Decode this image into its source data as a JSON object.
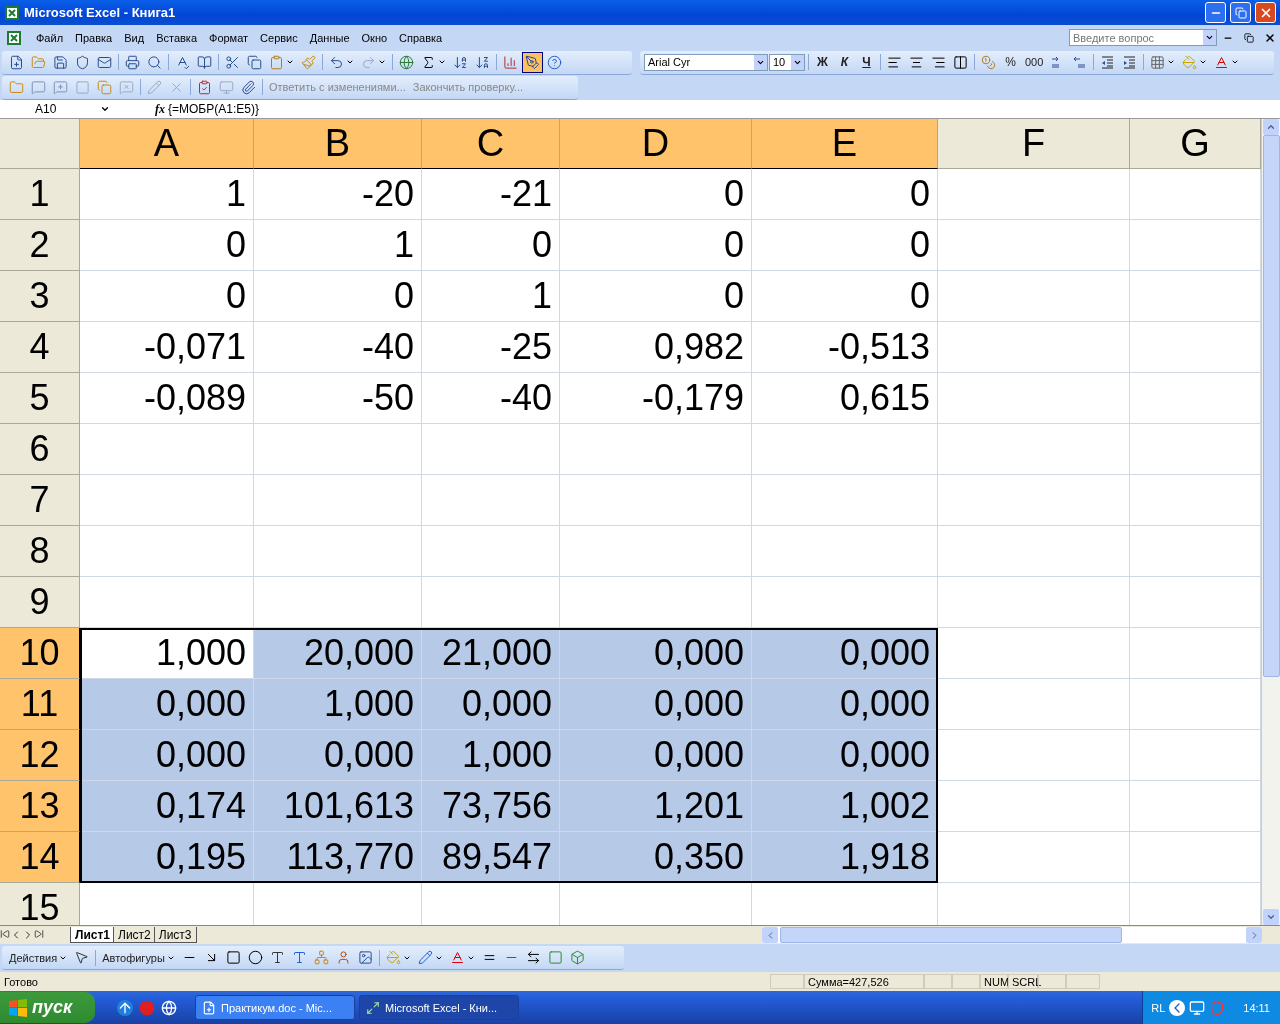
{
  "window": {
    "title": "Microsoft Excel - Книга1"
  },
  "menu": [
    "Файл",
    "Правка",
    "Вид",
    "Вставка",
    "Формат",
    "Сервис",
    "Данные",
    "Окно",
    "Справка"
  ],
  "question_box": {
    "placeholder": "Введите вопрос"
  },
  "formatting": {
    "font": "Arial Cyr",
    "size": "10",
    "bold": "Ж",
    "italic": "К",
    "underline": "Ч",
    "percent": "%",
    "thousands": "000"
  },
  "reviewing": {
    "reply": "Ответить с изменениями...",
    "end_review": "Закончить проверку..."
  },
  "formula_bar": {
    "name_box": "A10",
    "fx": "fx",
    "formula": "{=МОБР(A1:E5)}"
  },
  "columns": [
    {
      "label": "A",
      "selected": true
    },
    {
      "label": "B",
      "selected": true
    },
    {
      "label": "C",
      "selected": true
    },
    {
      "label": "D",
      "selected": true
    },
    {
      "label": "E",
      "selected": true
    },
    {
      "label": "F",
      "selected": false
    },
    {
      "label": "G",
      "selected": false
    }
  ],
  "rows": [
    {
      "label": "1",
      "selected": false,
      "cells": [
        {
          "value": "1",
          "selected": false
        },
        {
          "value": "-20",
          "selected": false
        },
        {
          "value": "-21",
          "selected": false
        },
        {
          "value": "0",
          "selected": false
        },
        {
          "value": "0",
          "selected": false
        }
      ]
    },
    {
      "label": "2",
      "selected": false,
      "cells": [
        {
          "value": "0",
          "selected": false
        },
        {
          "value": "1",
          "selected": false
        },
        {
          "value": "0",
          "selected": false
        },
        {
          "value": "0",
          "selected": false
        },
        {
          "value": "0",
          "selected": false
        }
      ]
    },
    {
      "label": "3",
      "selected": false,
      "cells": [
        {
          "value": "0",
          "selected": false
        },
        {
          "value": "0",
          "selected": false
        },
        {
          "value": "1",
          "selected": false
        },
        {
          "value": "0",
          "selected": false
        },
        {
          "value": "0",
          "selected": false
        }
      ]
    },
    {
      "label": "4",
      "selected": false,
      "cells": [
        {
          "value": "-0,071",
          "selected": false
        },
        {
          "value": "-40",
          "selected": false
        },
        {
          "value": "-25",
          "selected": false
        },
        {
          "value": "0,982",
          "selected": false
        },
        {
          "value": "-0,513",
          "selected": false
        }
      ]
    },
    {
      "label": "5",
      "selected": false,
      "cells": [
        {
          "value": "-0,089",
          "selected": false
        },
        {
          "value": "-50",
          "selected": false
        },
        {
          "value": "-40",
          "selected": false
        },
        {
          "value": "-0,179",
          "selected": false
        },
        {
          "value": "0,615",
          "selected": false
        }
      ]
    },
    {
      "label": "6",
      "selected": false
    },
    {
      "label": "7",
      "selected": false
    },
    {
      "label": "8",
      "selected": false
    },
    {
      "label": "9",
      "selected": false
    },
    {
      "label": "10",
      "selected": true,
      "cells": [
        {
          "value": "1,000",
          "selected": false
        },
        {
          "value": "20,000",
          "selected": true,
          "active": false
        },
        {
          "value": "21,000",
          "selected": true,
          "active": false
        },
        {
          "value": "0,000",
          "selected": true,
          "active": false
        },
        {
          "value": "0,000",
          "selected": true,
          "active": false
        }
      ]
    },
    {
      "label": "11",
      "selected": true,
      "cells": [
        {
          "value": "0,000",
          "selected": true,
          "active": false
        },
        {
          "value": "1,000",
          "selected": true,
          "active": false
        },
        {
          "value": "0,000",
          "selected": true,
          "active": false
        },
        {
          "value": "0,000",
          "selected": true,
          "active": false
        },
        {
          "value": "0,000",
          "selected": true,
          "active": false
        }
      ]
    },
    {
      "label": "12",
      "selected": true,
      "cells": [
        {
          "value": "0,000",
          "selected": true,
          "active": false
        },
        {
          "value": "0,000",
          "selected": true,
          "active": false
        },
        {
          "value": "1,000",
          "selected": true,
          "active": false
        },
        {
          "value": "0,000",
          "selected": true,
          "active": false
        },
        {
          "value": "0,000",
          "selected": true,
          "active": false
        }
      ]
    },
    {
      "label": "13",
      "selected": true,
      "cells": [
        {
          "value": "0,174",
          "selected": true,
          "active": false
        },
        {
          "value": "101,613",
          "selected": true,
          "active": false
        },
        {
          "value": "73,756",
          "selected": true,
          "active": false
        },
        {
          "value": "1,201",
          "selected": true,
          "active": false
        },
        {
          "value": "1,002",
          "selected": true,
          "active": false
        }
      ]
    },
    {
      "label": "14",
      "selected": true,
      "cells": [
        {
          "value": "0,195",
          "selected": true,
          "active": false
        },
        {
          "value": "113,770",
          "selected": true,
          "active": false
        },
        {
          "value": "89,547",
          "selected": true,
          "active": false
        },
        {
          "value": "0,350",
          "selected": true,
          "active": false
        },
        {
          "value": "1,918",
          "selected": true,
          "active": false
        }
      ]
    },
    {
      "label": "15",
      "selected": false
    }
  ],
  "sheet_tabs": [
    {
      "label": "Лист1",
      "selected": true
    },
    {
      "label": "Лист2",
      "selected": false
    },
    {
      "label": "Лист3",
      "selected": false
    }
  ],
  "drawing_toolbar": {
    "actions": "Действия",
    "autoshapes": "Автофигуры"
  },
  "status_bar": {
    "status": "Готово",
    "sum": "Сумма=427,526",
    "indicators": [
      "NUM",
      "SCRL"
    ]
  },
  "taskbar": {
    "start": "пуск",
    "tasks": [
      {
        "label": "Практикум.doc - Mic...",
        "selected": false
      },
      {
        "label": "Microsoft Excel - Кни...",
        "selected": true
      }
    ],
    "language": "RL",
    "clock": "14:11"
  }
}
